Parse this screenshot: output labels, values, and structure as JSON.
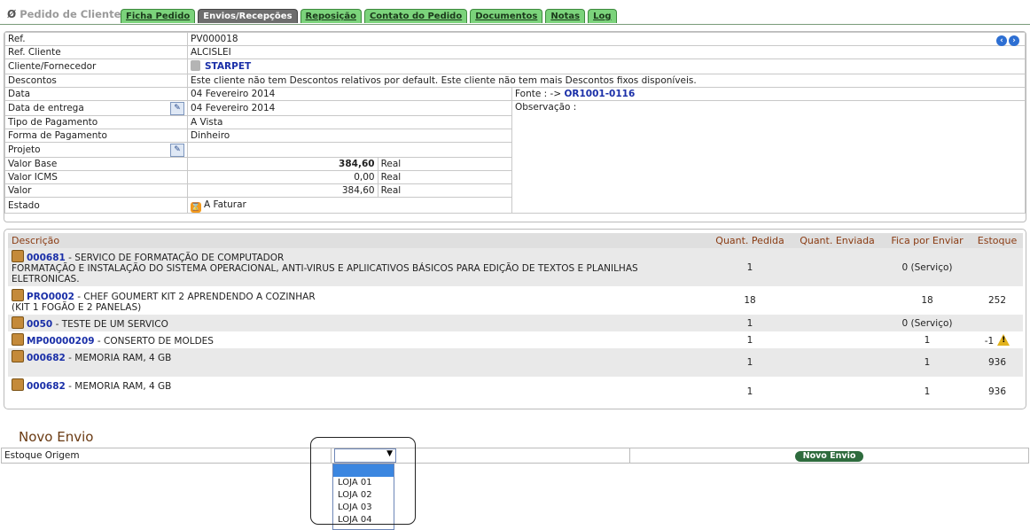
{
  "header": {
    "title": "Pedido de Cliente",
    "tabs": [
      {
        "label": "Ficha Pedido",
        "active": false
      },
      {
        "label": "Envios/Recepções",
        "active": true
      },
      {
        "label": "Reposição",
        "active": false
      },
      {
        "label": "Contato do Pedido",
        "active": false
      },
      {
        "label": "Documentos",
        "active": false
      },
      {
        "label": "Notas",
        "active": false
      },
      {
        "label": "Log",
        "active": false
      }
    ]
  },
  "info": {
    "ref_label": "Ref.",
    "ref_value": "PV000018",
    "ref_cliente_label": "Ref. Cliente",
    "ref_cliente_value": "ALCISLEI",
    "cliente_label": "Cliente/Fornecedor",
    "cliente_value": "STARPET",
    "descontos_label": "Descontos",
    "descontos_value": "Este cliente não tem Descontos relativos por default. Este cliente não tem mais Descontos fixos disponíveis.",
    "data_label": "Data",
    "data_value": "04 Fevereiro 2014",
    "fonte_label": "Fonte : ->",
    "fonte_value": "OR1001-0116",
    "entrega_label": "Data de entrega",
    "entrega_value": "04 Fevereiro 2014",
    "observacao_label": "Observação :",
    "tipo_pag_label": "Tipo de Pagamento",
    "tipo_pag_value": "A Vista",
    "forma_pag_label": "Forma de Pagamento",
    "forma_pag_value": "Dinheiro",
    "projeto_label": "Projeto",
    "valor_base_label": "Valor Base",
    "valor_base_value": "384,60",
    "valor_base_unit": "Real",
    "valor_icms_label": "Valor ICMS",
    "valor_icms_value": "0,00",
    "valor_icms_unit": "Real",
    "valor_label": "Valor",
    "valor_value": "384,60",
    "valor_unit": "Real",
    "estado_label": "Estado",
    "estado_value": "A Faturar"
  },
  "lines": {
    "headers": [
      "Descrição",
      "Quant. Pedida",
      "Quant. Enviada",
      "Fica por Enviar",
      "Estoque"
    ],
    "rows": [
      {
        "ref": "000681",
        "desc": " - SERVICO DE FORMATAÇÃO DE COMPUTADOR",
        "desc2": "FORMATAÇÃO E INSTALAÇÃO DO SISTEMA OPERACIONAL, ANTI-VIRUS E APLIICATIVOS BÁSICOS PARA EDIÇÃO DE TEXTOS E PLANILHAS ELETRONICAS.",
        "pedida": "1",
        "enviada": "",
        "fica": "0 (Serviço)",
        "estoque": ""
      },
      {
        "ref": "PRO0002",
        "desc": " - CHEF GOUMERT KIT 2 APRENDENDO A COZINHAR",
        "desc2": "(KIT 1 FOGÃO E 2 PANELAS)",
        "pedida": "18",
        "enviada": "",
        "fica": "18",
        "estoque": "252"
      },
      {
        "ref": "0050",
        "desc": " - TESTE DE UM SERVICO",
        "desc2": "",
        "pedida": "1",
        "enviada": "",
        "fica": "0 (Serviço)",
        "estoque": ""
      },
      {
        "ref": "MP00000209",
        "desc": " - CONSERTO DE MOLDES",
        "desc2": "",
        "pedida": "1",
        "enviada": "",
        "fica": "1",
        "estoque": "-1"
      },
      {
        "ref": "000682",
        "desc": " - MEMORIA RAM, 4 GB",
        "desc2": "",
        "pedida": "1",
        "enviada": "",
        "fica": "1",
        "estoque": "936"
      },
      {
        "ref": "000682",
        "desc": " - MEMORIA RAM, 4 GB",
        "desc2": "",
        "pedida": "1",
        "enviada": "",
        "fica": "1",
        "estoque": "936"
      }
    ]
  },
  "novo_envio": {
    "title": "Novo Envio",
    "estoque_label": "Estoque Origem",
    "select_value": "",
    "button_label": "Novo Envio",
    "options": [
      "",
      "LOJA 01",
      "LOJA 02",
      "LOJA 03",
      "LOJA 04"
    ]
  }
}
